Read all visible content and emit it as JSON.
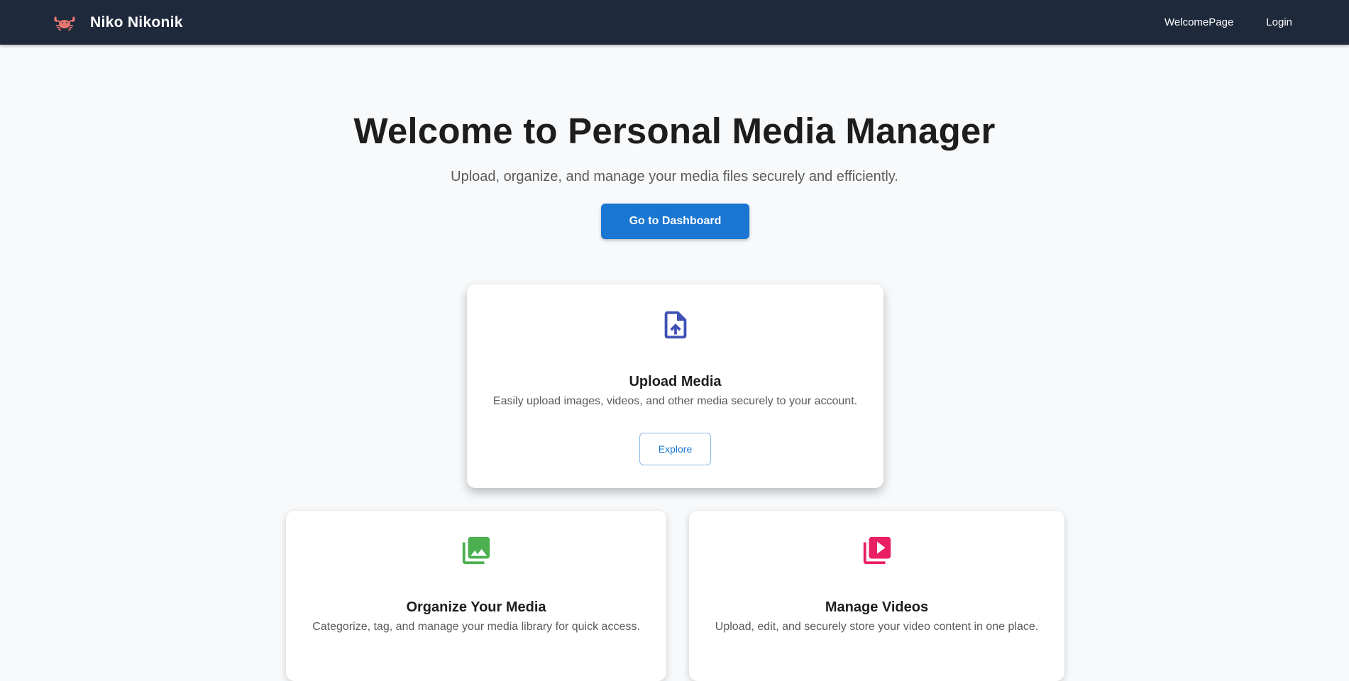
{
  "navbar": {
    "brand_name": "Niko Nikonik",
    "logo_icon": "crab-icon",
    "links": [
      "WelcomePage",
      "Login"
    ]
  },
  "hero": {
    "title": "Welcome to Personal Media Manager",
    "subtitle": "Upload, organize, and manage your media files securely and efficiently.",
    "cta_label": "Go to Dashboard"
  },
  "features": [
    {
      "icon": "file-upload-icon",
      "icon_color": "#3f51b5",
      "title": "Upload Media",
      "description": "Easily upload images, videos, and other media securely to your account.",
      "button_label": "Explore"
    },
    {
      "icon": "photo-library-icon",
      "icon_color": "#4caf50",
      "title": "Organize Your Media",
      "description": "Categorize, tag, and manage your media library for quick access."
    },
    {
      "icon": "video-library-icon",
      "icon_color": "#e91e63",
      "title": "Manage Videos",
      "description": "Upload, edit, and securely store your video content in one place."
    }
  ],
  "colors": {
    "navbar_bg": "#1e293b",
    "primary": "#1976d2",
    "page_bg": "#f7f9fb"
  }
}
